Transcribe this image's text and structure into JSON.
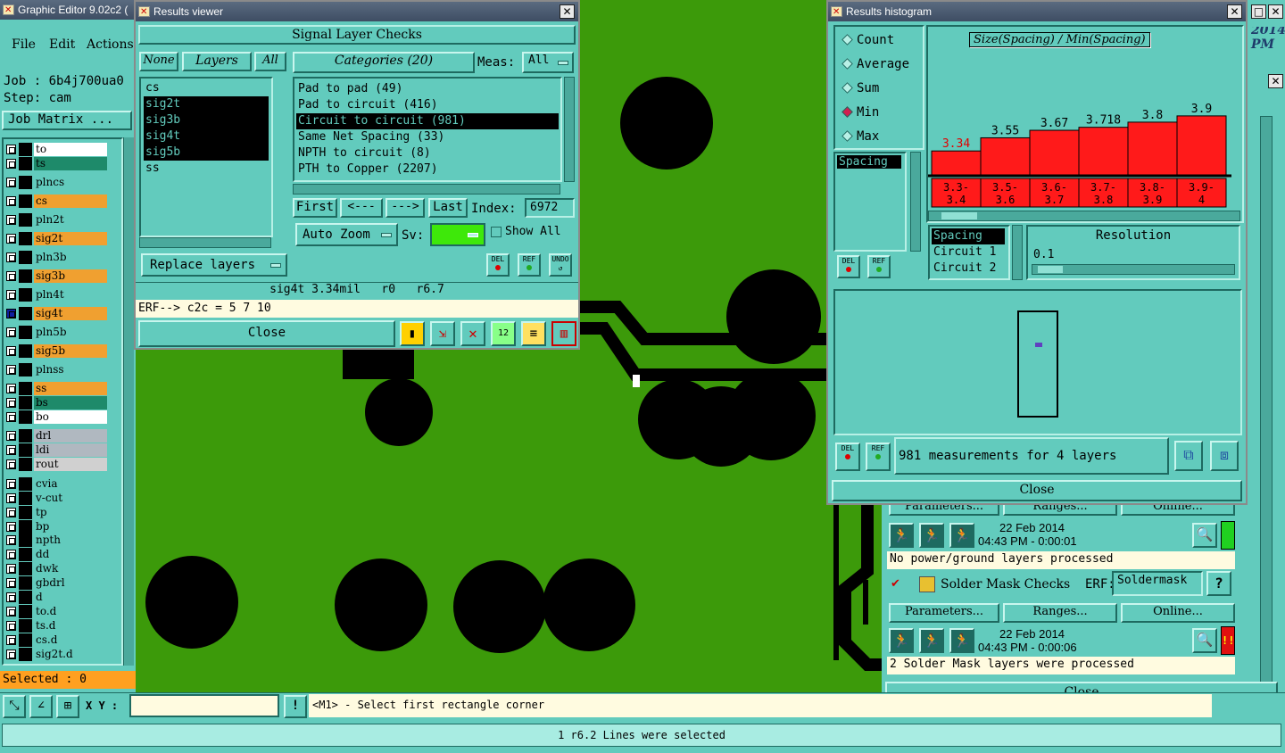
{
  "main_title": "Graphic Editor 9.02c2 (",
  "menu": {
    "file": "File",
    "edit": "Edit",
    "actions": "Actions"
  },
  "job": "Job : 6b4j700ua0",
  "step": "Step: cam",
  "job_matrix": "Job Matrix ...",
  "layers": [
    {
      "name": "to",
      "color": "#ffffff"
    },
    {
      "name": "ts",
      "color": "#1e8a6a"
    },
    {
      "name": "plncs",
      "color": "#62cbbd"
    },
    {
      "name": "cs",
      "color": "#f0a030"
    },
    {
      "name": "pln2t",
      "color": "#62cbbd"
    },
    {
      "name": "sig2t",
      "color": "#f0a030"
    },
    {
      "name": "pln3b",
      "color": "#62cbbd"
    },
    {
      "name": "sig3b",
      "color": "#f0a030"
    },
    {
      "name": "pln4t",
      "color": "#62cbbd"
    },
    {
      "name": "sig4t",
      "color": "#f0a030"
    },
    {
      "name": "pln5b",
      "color": "#62cbbd"
    },
    {
      "name": "sig5b",
      "color": "#f0a030"
    },
    {
      "name": "plnss",
      "color": "#62cbbd"
    },
    {
      "name": "ss",
      "color": "#f0a030"
    },
    {
      "name": "bs",
      "color": "#1e8a6a"
    },
    {
      "name": "bo",
      "color": "#ffffff"
    },
    {
      "name": "drl",
      "color": "#b0b8c0"
    },
    {
      "name": "ldi",
      "color": "#b0b8c0"
    },
    {
      "name": "rout",
      "color": "#d0d0d0"
    },
    {
      "name": "cvia",
      "color": "#62cbbd"
    },
    {
      "name": "v-cut",
      "color": "#62cbbd"
    },
    {
      "name": "tp",
      "color": "#62cbbd"
    },
    {
      "name": "bp",
      "color": "#62cbbd"
    },
    {
      "name": "npth",
      "color": "#62cbbd"
    },
    {
      "name": "dd",
      "color": "#62cbbd"
    },
    {
      "name": "dwk",
      "color": "#62cbbd"
    },
    {
      "name": "gbdrl",
      "color": "#62cbbd"
    },
    {
      "name": "d",
      "color": "#62cbbd"
    },
    {
      "name": "to.d",
      "color": "#62cbbd"
    },
    {
      "name": "ts.d",
      "color": "#62cbbd"
    },
    {
      "name": "cs.d",
      "color": "#62cbbd"
    },
    {
      "name": "sig2t.d",
      "color": "#62cbbd"
    }
  ],
  "selected": "Selected : 0",
  "xy_label": "X Y :",
  "prompt": "<M1> - Select first rectangle corner",
  "status": "1 r6.2 Lines were selected",
  "results_viewer": {
    "title": "Results viewer",
    "header": "Signal Layer Checks",
    "none": "None",
    "layers": "Layers",
    "all": "All",
    "categories": "Categories (20)",
    "meas_label": "Meas:",
    "meas_value": "All",
    "layer_list": [
      "cs",
      "sig2t",
      "sig3b",
      "sig4t",
      "sig5b",
      "ss"
    ],
    "category_list": [
      "Pad to pad (49)",
      "Pad to circuit (416)",
      "Circuit to circuit (981)",
      "Same Net Spacing (33)",
      "NPTH to circuit (8)",
      "PTH to Copper (2207)"
    ],
    "first": "First",
    "prev": "<---",
    "next": "--->",
    "last": "Last",
    "index_label": "Index:",
    "index_value": "6972",
    "auto_zoom": "Auto Zoom",
    "sv_label": "Sv:",
    "show_all": "Show All",
    "replace_layers": "Replace layers",
    "info": "sig4t 3.34mil   r0   r6.7",
    "erf": "ERF--> c2c = 5 7 10",
    "close": "Close",
    "del": "DEL",
    "ref": "REF",
    "undo": "UNDO"
  },
  "histogram": {
    "title": "Results histogram",
    "modes": [
      "Count",
      "Average",
      "Sum",
      "Min",
      "Max"
    ],
    "selected_mode": "Min",
    "chart_title": "Size(Spacing) / Min(Spacing)",
    "field": "Spacing",
    "field_list": [
      "Spacing",
      "Circuit 1",
      "Circuit 2"
    ],
    "resolution_label": "Resolution",
    "resolution_value": "0.1",
    "measurements": "981 measurements for 4 layers",
    "close": "Close"
  },
  "chart_data": {
    "type": "bar",
    "title": "Size(Spacing) / Min(Spacing)",
    "categories": [
      "3.3-3.4",
      "3.5-3.6",
      "3.6-3.7",
      "3.7-3.8",
      "3.8-3.9",
      "3.9-4"
    ],
    "values": [
      3.34,
      3.55,
      3.67,
      3.718,
      3.8,
      3.9
    ],
    "value_labels": [
      "3.34",
      "3.55",
      "3.67",
      "3.718",
      "3.8",
      "3.9"
    ],
    "highlight_index": 0,
    "bar_color": "#ff1a1a"
  },
  "checklist": {
    "parameters": "Parameters...",
    "ranges": "Ranges...",
    "online": "Online...",
    "date1": "22 Feb 2014",
    "time1": "04:43 PM - 0:00:01",
    "msg1": "No power/ground layers processed",
    "solder_title": "Solder Mask Checks",
    "erf_label": "ERF:",
    "erf_value": "Soldermask",
    "date2": "22 Feb 2014",
    "time2": "04:43 PM - 0:00:06",
    "msg2": "2 Solder Mask layers were processed",
    "close": "Close",
    "corner_date": "2014",
    "corner_pm": "PM"
  }
}
